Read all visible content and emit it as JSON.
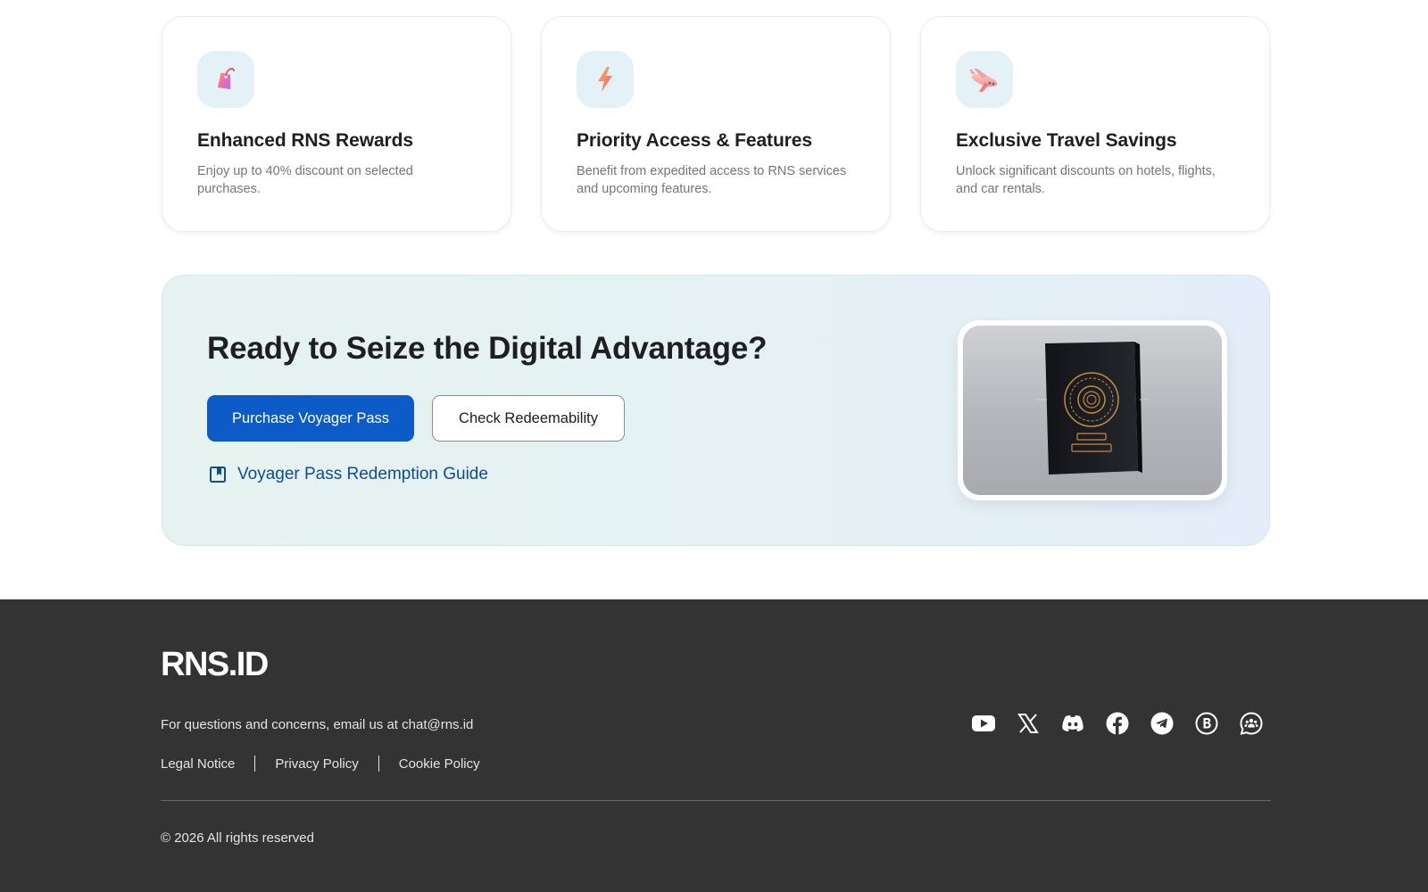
{
  "features": {
    "items": [
      {
        "icon": "tag-icon",
        "title": "Enhanced RNS Rewards",
        "description": "Enjoy up to 40% discount on selected purchases."
      },
      {
        "icon": "lightning-icon",
        "title": "Priority Access & Features",
        "description": "Benefit from expedited access to RNS services and upcoming features."
      },
      {
        "icon": "airplane-icon",
        "title": "Exclusive Travel Savings",
        "description": "Unlock significant discounts on hotels, flights, and car rentals."
      }
    ]
  },
  "cta": {
    "title": "Ready to Seize the Digital Advantage?",
    "primary_button": "Purchase Voyager Pass",
    "secondary_button": "Check Redeemability",
    "guide_link": "Voyager Pass Redemption Guide",
    "image": "voyager-pass-passport-image"
  },
  "footer": {
    "logo": "RNS.ID",
    "contact": "For questions and concerns, email us at chat@rns.id",
    "links": [
      "Legal Notice",
      "Privacy Policy",
      "Cookie Policy"
    ],
    "social": [
      "youtube-icon",
      "x-icon",
      "discord-icon",
      "facebook-icon",
      "telegram-icon",
      "b-icon",
      "chat-group-icon"
    ],
    "copyright": "© 2026 All rights reserved"
  },
  "colors": {
    "primary_button": "#0d5bc6",
    "link": "#0c4c98",
    "footer_bg": "#333333",
    "icon_tile": "#e4f1f6"
  }
}
